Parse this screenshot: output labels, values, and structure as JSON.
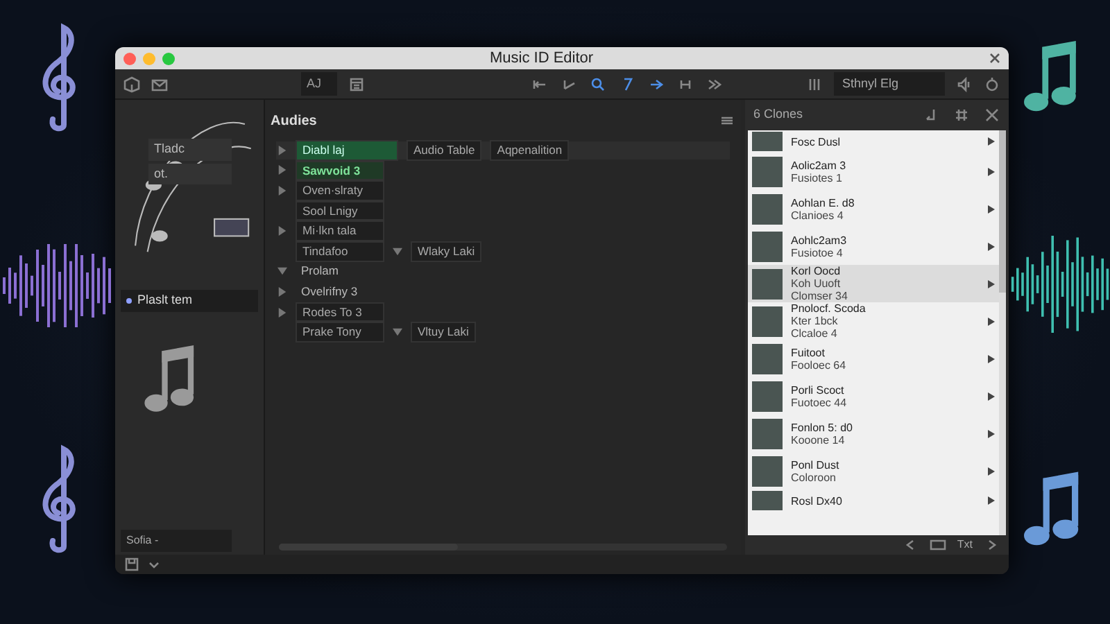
{
  "window": {
    "title": "Music ID Editor"
  },
  "toolbar": {
    "field_value": "AJ",
    "search_value": "Sthnyl Elg"
  },
  "sidebar": {
    "items": [
      {
        "label": "Tladc",
        "selected": false
      },
      {
        "label": "ot.",
        "selected": false
      },
      {
        "label": "Plaslt tem",
        "selected": true
      }
    ],
    "footer_select": "Sofia -"
  },
  "main": {
    "title": "Audies",
    "rows": [
      {
        "kind": "branch",
        "expanded": false,
        "label": "Diabl laj",
        "selected": true,
        "tags": [
          "Audio Table",
          "Aqpenalition"
        ]
      },
      {
        "kind": "branch",
        "expanded": false,
        "label": "Sawvoid 3",
        "selected": true,
        "tags": []
      },
      {
        "kind": "branch",
        "expanded": false,
        "label": "Oven·slraty",
        "selected": false,
        "tags": []
      },
      {
        "kind": "leaf",
        "label": "Sool Lnigy",
        "selected": false,
        "tags": []
      },
      {
        "kind": "branch",
        "expanded": false,
        "label": "Mi·lkn tala",
        "selected": false,
        "tags": []
      },
      {
        "kind": "leaf",
        "label": "Tindafoo",
        "selected": false,
        "tags": [
          "Wlaky Laki"
        ]
      },
      {
        "kind": "heading",
        "expanded": true,
        "label": "Prolam",
        "selected": false,
        "tags": []
      },
      {
        "kind": "heading",
        "expanded": false,
        "label": "Ovelrifny 3",
        "selected": false,
        "tags": []
      },
      {
        "kind": "branch",
        "expanded": false,
        "label": "Rodes To 3",
        "selected": false,
        "tags": []
      },
      {
        "kind": "leaf",
        "label": "Prake Tony",
        "selected": false,
        "tags": [
          "Vltuy Laki"
        ]
      }
    ]
  },
  "clones": {
    "title": "6 Clones",
    "items": [
      {
        "lines": [
          "Fosc Dusl"
        ],
        "selected": false
      },
      {
        "lines": [
          "Aolic2am 3",
          "Fusiotes 1"
        ],
        "selected": false
      },
      {
        "lines": [
          "Aohlan E. d8",
          "Clanioes 4"
        ],
        "selected": false
      },
      {
        "lines": [
          "Aohlc2am3",
          "Fusiotoe 4"
        ],
        "selected": false
      },
      {
        "lines": [
          "Korl Oocd",
          "Koh Uuoft",
          "Clomser 34"
        ],
        "selected": true
      },
      {
        "lines": [
          "Pnolocf. Scoda",
          "Kter 1bck",
          "Clcaloe 4"
        ],
        "selected": false
      },
      {
        "lines": [
          "Fuitoot",
          "Fooloec 64"
        ],
        "selected": false
      },
      {
        "lines": [
          "Porli Scoct",
          "Fuotoec 44"
        ],
        "selected": false
      },
      {
        "lines": [
          "Fonlon 5: d0",
          "Kooone 14"
        ],
        "selected": false
      },
      {
        "lines": [
          "Ponl Dust",
          "Coloroon"
        ],
        "selected": false
      },
      {
        "lines": [
          "Rosl Dx40"
        ],
        "selected": false
      }
    ],
    "footer_label": "Txt"
  }
}
